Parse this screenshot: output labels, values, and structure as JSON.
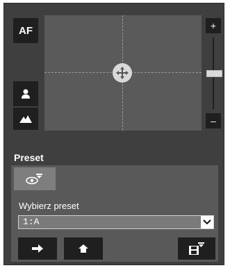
{
  "camera": {
    "af_label": "AF",
    "zoom_in": "+",
    "zoom_out": "–"
  },
  "preset": {
    "section_title": "Preset",
    "choose_label": "Wybierz preset",
    "selected": "1:A"
  },
  "icons": [
    "person-icon",
    "mountain-icon",
    "move-icon",
    "preset-view-icon",
    "arrow-right-icon",
    "home-icon",
    "save-preset-icon",
    "chevron-down-icon"
  ],
  "colors": {
    "panel_bg": "#3f3f3f",
    "button_bg": "#1f1f1f",
    "pad_bg": "#5a5a5a",
    "preset_bg": "#595959"
  }
}
